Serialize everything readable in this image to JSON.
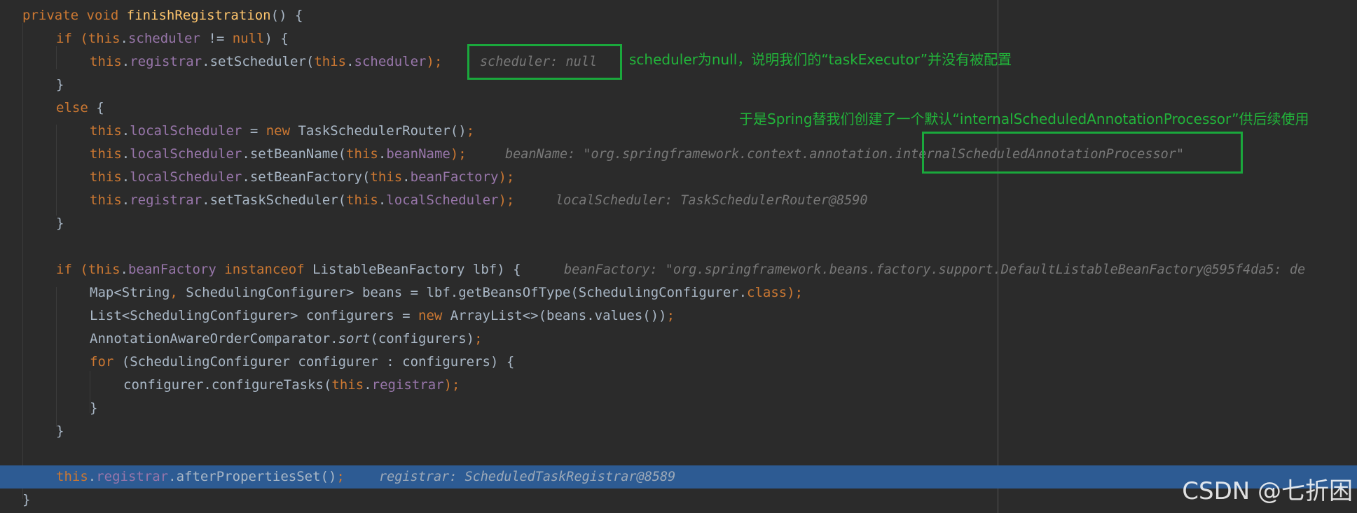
{
  "editor": {
    "lines": {
      "l1": {
        "a": "private void ",
        "b": "finishRegistration",
        "c": "() {"
      },
      "l2": {
        "a": "if (",
        "b": "this",
        "c": ".",
        "d": "scheduler",
        "e": " != ",
        "f": "null",
        "g": ") {"
      },
      "l3": {
        "a": "this",
        "b": ".",
        "c": "registrar",
        "d": ".setScheduler(",
        "e": "this",
        "f": ".",
        "g": "scheduler",
        "h": ");",
        "hint": "scheduler: null"
      },
      "l4": {
        "a": "}"
      },
      "l5": {
        "a": "else",
        "b": " {"
      },
      "l6": {
        "a": "this",
        "b": ".",
        "c": "localScheduler",
        "d": " = ",
        "e": "new",
        "f": " TaskSchedulerRouter()",
        "g": ";"
      },
      "l7": {
        "a": "this",
        "b": ".",
        "c": "localScheduler",
        "d": ".setBeanName(",
        "e": "this",
        "f": ".",
        "g": "beanName",
        "h": ");",
        "hint": "beanName: \"org.springframework.context.annotation.internalScheduledAnnotationProcessor\""
      },
      "l8": {
        "a": "this",
        "b": ".",
        "c": "localScheduler",
        "d": ".setBeanFactory(",
        "e": "this",
        "f": ".",
        "g": "beanFactory",
        "h": ");"
      },
      "l9": {
        "a": "this",
        "b": ".",
        "c": "registrar",
        "d": ".setTaskScheduler(",
        "e": "this",
        "f": ".",
        "g": "localScheduler",
        "h": ");",
        "hint": "localScheduler: TaskSchedulerRouter@8590"
      },
      "l10": {
        "a": "}"
      },
      "l11": {
        "a": "if (",
        "b": "this",
        "c": ".",
        "d": "beanFactory",
        "e": " instanceof",
        "f": " ListableBeanFactory lbf) {",
        "hint": "beanFactory: \"org.springframework.beans.factory.support.DefaultListableBeanFactory@595f4da5: de"
      },
      "l12": {
        "a": "Map<String",
        "b": ",",
        "c": " SchedulingConfigurer> beans = lbf.getBeansOfType(SchedulingConfigurer.",
        "d": "class",
        "e": ");"
      },
      "l13": {
        "a": "List<SchedulingConfigurer> configurers = ",
        "b": "new",
        "c": " ArrayList<>(beans.values())",
        "d": ";"
      },
      "l14": {
        "a": "AnnotationAwareOrderComparator.",
        "b": "sort",
        "c": "(configurers)",
        "d": ";"
      },
      "l15": {
        "a": "for",
        "b": " (SchedulingConfigurer configurer : configurers) {"
      },
      "l16": {
        "a": "configurer.configureTasks(",
        "b": "this",
        "c": ".",
        "d": "registrar",
        "e": ");"
      },
      "l17": {
        "a": "}"
      },
      "l18": {
        "a": "}"
      },
      "l19": {
        "a": "this",
        "b": ".",
        "c": "registrar",
        "d": ".afterPropertiesSet()",
        "e": ";",
        "hint": "registrar: ScheduledTaskRegistrar@8589"
      },
      "l20": {
        "a": "}"
      }
    }
  },
  "annotations": {
    "note1": "scheduler为null，说明我们的“taskExecutor”并没有被配置",
    "note2": "于是Spring替我们创建了一个默认“internalScheduledAnnotationProcessor”供后续使用"
  },
  "watermark": "CSDN @七折困",
  "colors": {
    "background": "#2b2b2b",
    "keyword": "#cc7832",
    "field": "#9876aa",
    "method_declaration": "#ffc66d",
    "plain": "#a9b7c6",
    "inlay_hint": "#787878",
    "current_line": "#2d5b93",
    "annotation_green": "#22b43a"
  }
}
